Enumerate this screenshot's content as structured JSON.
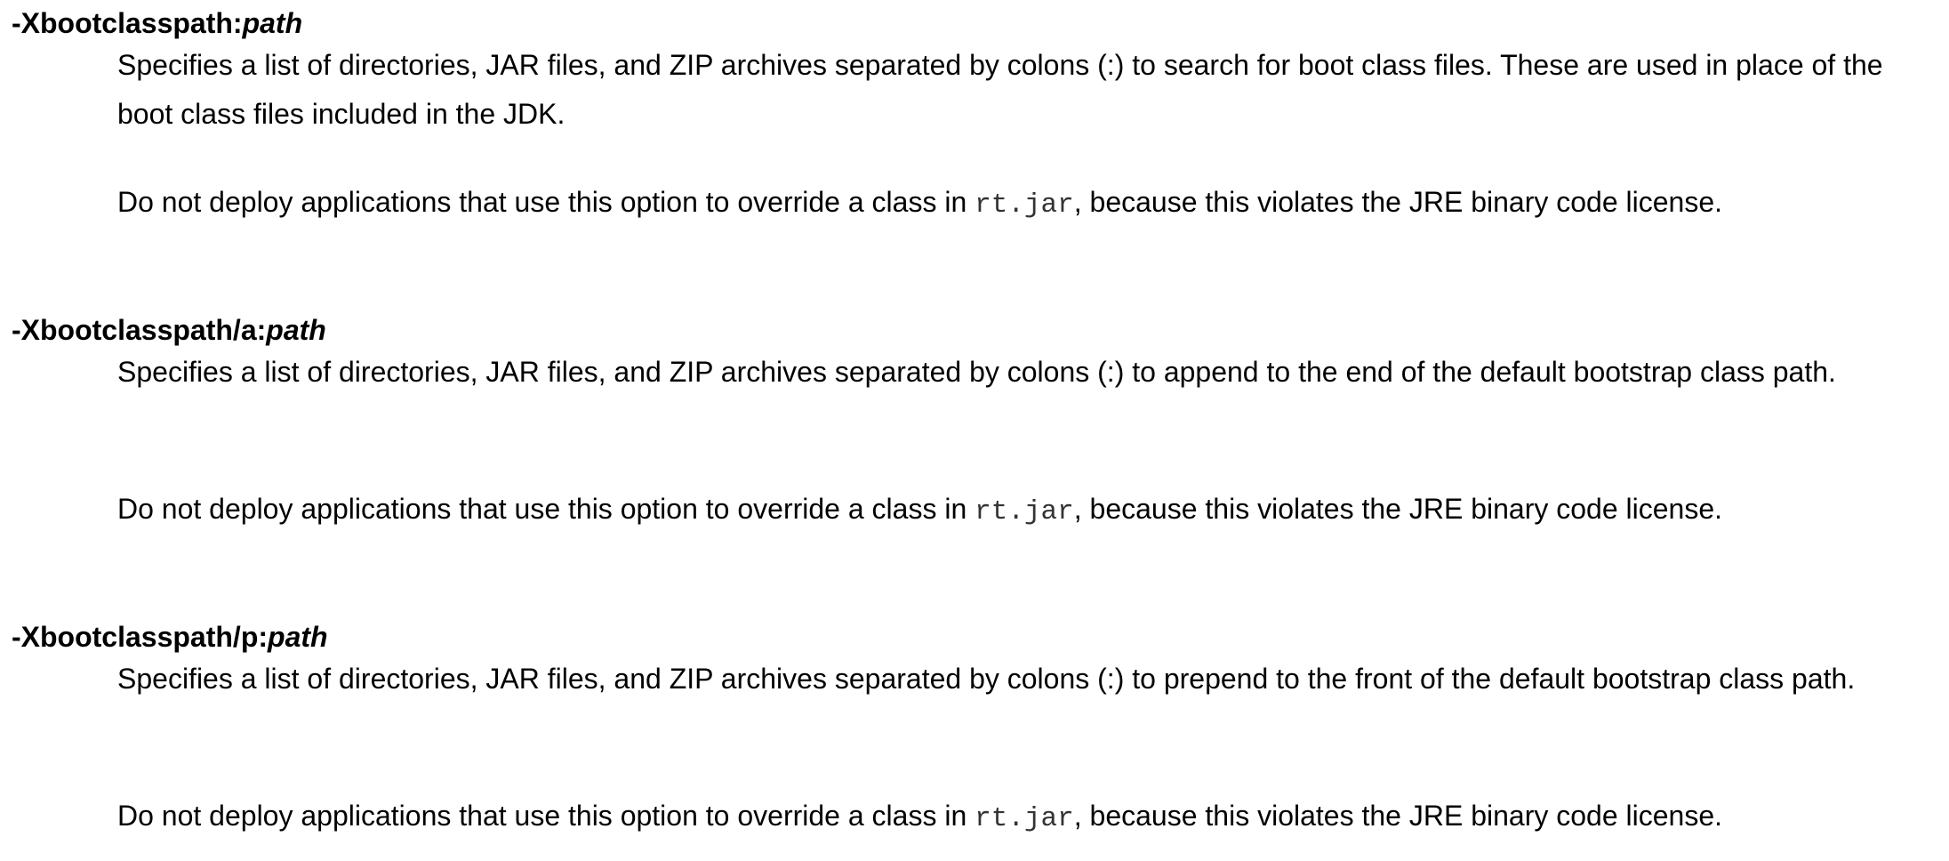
{
  "options": [
    {
      "term_prefix": "-Xbootclasspath:",
      "term_arg": "path",
      "desc": "Specifies a list of directories, JAR files, and ZIP archives separated by colons (:) to search for boot class files. These are used in place of the boot class files included in the JDK.",
      "note_before": "Do not deploy applications that use this option to override a class in ",
      "note_code": "rt.jar",
      "note_after": ", because this violates the JRE binary code license."
    },
    {
      "term_prefix": "-Xbootclasspath/a:",
      "term_arg": "path",
      "desc": "Specifies a list of directories, JAR files, and ZIP archives separated by colons (:) to append to the end of the default bootstrap class path.",
      "note_before": "Do not deploy applications that use this option to override a class in ",
      "note_code": "rt.jar",
      "note_after": ", because this violates the JRE binary code license."
    },
    {
      "term_prefix": "-Xbootclasspath/p:",
      "term_arg": "path",
      "desc": "Specifies a list of directories, JAR files, and ZIP archives separated by colons (:) to prepend to the front of the default bootstrap class path.",
      "note_before": "Do not deploy applications that use this option to override a class in ",
      "note_code": "rt.jar",
      "note_after": ", because this violates the JRE binary code license."
    }
  ]
}
